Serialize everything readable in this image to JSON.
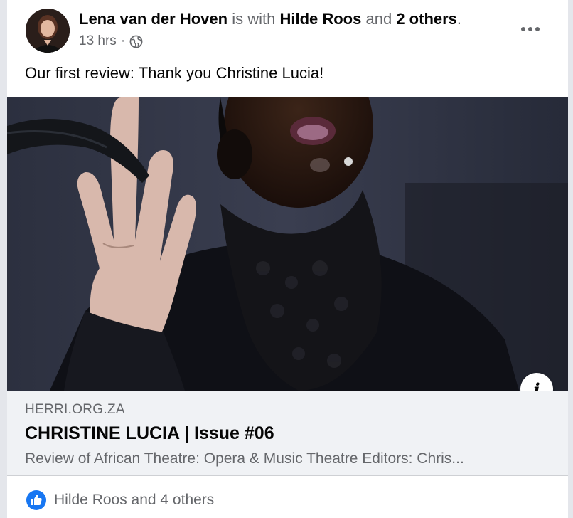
{
  "post": {
    "author": "Lena van der Hoven",
    "with_text": "is with",
    "tagged_name": "Hilde Roos",
    "and_text": "and",
    "others_link": "2 others",
    "period": ".",
    "time": "13 hrs",
    "separator": "·",
    "privacy_icon": "globe-icon",
    "text": "Our first review: Thank you Christine Lucia!"
  },
  "menu": {
    "more_icon": "more-horizontal-icon",
    "more_label": "•••"
  },
  "link_preview": {
    "domain": "HERRI.ORG.ZA",
    "title": "CHRISTINE LUCIA | Issue #06",
    "description": "Review of African Theatre: Opera & Music Theatre Editors: Chris...",
    "info_label": "i"
  },
  "reactions": {
    "icon": "like-icon",
    "text": "Hilde Roos and 4 others"
  },
  "colors": {
    "like_blue": "#1877f2",
    "secondary_text": "#65676b",
    "preview_bg": "#f0f2f5"
  }
}
